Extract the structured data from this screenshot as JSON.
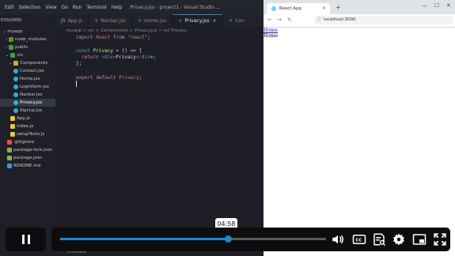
{
  "vscode": {
    "menu": [
      "Edit",
      "Selection",
      "View",
      "Go",
      "Run",
      "Terminal",
      "Help"
    ],
    "window_title": "Privacy.jsx - project1 - Visual Studio ...",
    "explorer_title": "EXPLORER",
    "tabs": [
      {
        "label": "App.js",
        "active": false
      },
      {
        "label": "Navbar.jsx",
        "active": false
      },
      {
        "label": "Home.jsx",
        "active": false
      },
      {
        "label": "Privacy.jsx",
        "active": true
      },
      {
        "label": "Con",
        "active": false
      }
    ],
    "breadcrumb": "myapp > src > Components > Privacy.jsx > [e] Privacy",
    "tree": [
      {
        "label": "myapp",
        "depth": 0,
        "kind": "folder-open"
      },
      {
        "label": "node_modules",
        "depth": 1,
        "kind": "folder"
      },
      {
        "label": "public",
        "depth": 1,
        "kind": "folder"
      },
      {
        "label": "src",
        "depth": 1,
        "kind": "folder-open"
      },
      {
        "label": "Components",
        "depth": 2,
        "kind": "folder-open"
      },
      {
        "label": "Contact.jsx",
        "depth": 3,
        "kind": "react"
      },
      {
        "label": "Home.jsx",
        "depth": 3,
        "kind": "react"
      },
      {
        "label": "Loginform.jsx",
        "depth": 3,
        "kind": "react"
      },
      {
        "label": "Navbar.jsx",
        "depth": 3,
        "kind": "react"
      },
      {
        "label": "Privacy.jsx",
        "depth": 3,
        "kind": "react",
        "selected": true
      },
      {
        "label": "Signup.jsx",
        "depth": 3,
        "kind": "react"
      },
      {
        "label": "App.js",
        "depth": 2,
        "kind": "js"
      },
      {
        "label": "index.js",
        "depth": 2,
        "kind": "js"
      },
      {
        "label": "setupTests.js",
        "depth": 2,
        "kind": "js"
      },
      {
        "label": ".gitignore",
        "depth": 1,
        "kind": "git"
      },
      {
        "label": "package-lock.json",
        "depth": 1,
        "kind": "json"
      },
      {
        "label": "package.json",
        "depth": 1,
        "kind": "json"
      },
      {
        "label": "README.md",
        "depth": 1,
        "kind": "md"
      }
    ],
    "code": {
      "line1": {
        "k1": "import",
        "id1": "React",
        "k2": "from",
        "s1": "\"react\"",
        "p1": ";"
      },
      "line3": {
        "k1": "const",
        "id1": "Privacy",
        "p1": " = () => {"
      },
      "line4": {
        "k1": "return",
        "p0": " <",
        "t1": "div",
        "p1": ">",
        "txt": "Privacy",
        "p2": "</",
        "t2": "div",
        "p3": ">;"
      },
      "line5": {
        "p1": "};"
      },
      "line7": {
        "k1": "export",
        "k2": "default",
        "id1": "Privacy",
        "p1": ";"
      }
    },
    "terminal_label": "TERMINAL"
  },
  "browser": {
    "tab_title": "React App",
    "url": "localhost:3000",
    "page_link": "Home",
    "page_text": "Home"
  },
  "player": {
    "time": "04:58",
    "progress": 0.63,
    "buffered": 0.63
  },
  "colors": {
    "accent": "#1c8ad8",
    "editor_bg": "#1e1f26",
    "keyword": "#c586c0",
    "string": "#ce9178"
  }
}
